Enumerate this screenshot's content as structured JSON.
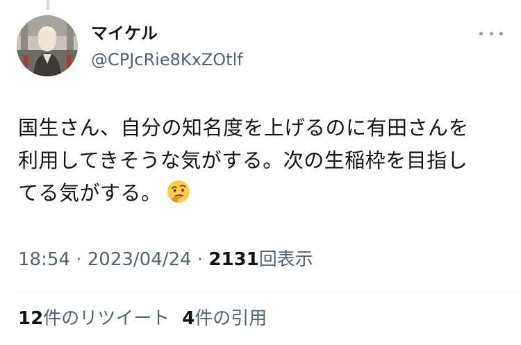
{
  "user": {
    "display_name": "マイケル",
    "handle": "@CPJcRie8KxZOtlf"
  },
  "more_icon": "more-horizontal-icon",
  "tweet": {
    "lines": [
      "国生さん、自分の知名度を上げるのに有田さんを",
      "利用してきそうな気がする。次の生稲枠を目指し",
      "てる気がする。"
    ],
    "emoji": "thinking-face"
  },
  "meta": {
    "time": "18:54",
    "separator": "·",
    "date": "2023/04/24",
    "views_count": "2131",
    "views_label": "回表示"
  },
  "stats": {
    "retweets_count": "12",
    "retweets_label": "件のリツイート",
    "quotes_count": "4",
    "quotes_label": "件の引用"
  },
  "colors": {
    "text": "#0f1419",
    "secondary": "#536471",
    "divider": "#eff3f4"
  }
}
